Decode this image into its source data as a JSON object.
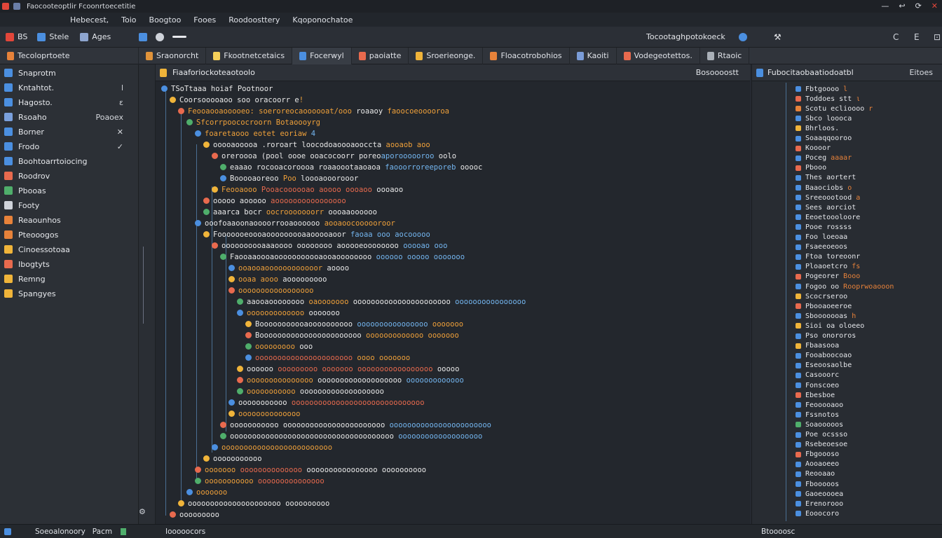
{
  "window": {
    "title": "Faocooteoptlir Fcoonrtoecetitie",
    "controls": [
      "—",
      "↩",
      "⟳",
      "✕"
    ]
  },
  "menubar": {
    "items": [
      "Hebecest,",
      "Toio",
      "Boogtoo",
      "Fooes",
      "Roodoosttery",
      "Kqoponochatoe"
    ]
  },
  "toolbar": {
    "left": [
      {
        "icon": "app-icon",
        "label": "BS"
      },
      {
        "icon": "style-icon",
        "label": "Stele"
      },
      {
        "icon": "apps-icon",
        "label": "Ages"
      }
    ],
    "center_title": "Tocootaghpotokoeck",
    "controls": [
      "C",
      "E",
      "⊡"
    ]
  },
  "tabs": [
    {
      "label": "Sraonorcht",
      "active": false,
      "color": "#e0933a"
    },
    {
      "label": "Fkootnetcetaics",
      "active": false,
      "color": "#f5d05a"
    },
    {
      "label": "Focerwyl",
      "active": true,
      "color": "#4b8fe0"
    },
    {
      "label": "paoiatte",
      "active": false,
      "color": "#e86a4e"
    },
    {
      "label": "Sroerieonge.",
      "active": false,
      "color": "#f0b43a"
    },
    {
      "label": "Floacotrobohios",
      "active": false,
      "color": "#e7823a"
    },
    {
      "label": "Kaoiti",
      "active": false,
      "color": "#7a9cd8"
    },
    {
      "label": "Vodegeotettos.",
      "active": false,
      "color": "#e86a4e"
    },
    {
      "label": "Rtaoic",
      "active": false,
      "color": "#aab0b8"
    }
  ],
  "sidebar": {
    "header": "Tecoloprtoete",
    "items": [
      {
        "label": "Snaprotm",
        "color": "#4b8fe0",
        "meta": ""
      },
      {
        "label": "Kntahtot.",
        "color": "#4b8fe0",
        "meta": "l"
      },
      {
        "label": "Hagosto.",
        "color": "#4b8fe0",
        "meta": "ε"
      },
      {
        "label": "Rsoaho",
        "color": "#7aa0dc",
        "meta": "Poaoex"
      },
      {
        "label": "Borner",
        "color": "#4b8fe0",
        "meta": "✕"
      },
      {
        "label": "Frodo",
        "color": "#4b8fe0",
        "meta": "✓"
      },
      {
        "label": "Boohtoarrtoiocing",
        "color": "#4b8fe0",
        "meta": ""
      },
      {
        "label": "Roodrov",
        "color": "#e86a4e",
        "meta": ""
      },
      {
        "label": "Pbooas",
        "color": "#4fae6b",
        "meta": ""
      },
      {
        "label": "Footy",
        "color": "#cfd3da",
        "meta": ""
      },
      {
        "label": "Reaounhos",
        "color": "#e7823a",
        "meta": ""
      },
      {
        "label": "Pteooogos",
        "color": "#e7823a",
        "meta": ""
      },
      {
        "label": "Cinoessotoaa",
        "color": "#f0b43a",
        "meta": ""
      },
      {
        "label": "Ibogtyts",
        "color": "#e86a4e",
        "meta": ""
      },
      {
        "label": "Remng",
        "color": "#f0b43a",
        "meta": ""
      },
      {
        "label": "Spangyes",
        "color": "#f0b43a",
        "meta": ""
      }
    ]
  },
  "editor": {
    "title": "Fiaaforiockoteaotoolo",
    "right_label": "Bosoooostt"
  },
  "outline": {
    "title": "Fubocitaobaatiodoatbl",
    "right_label": "Eitoes",
    "items": [
      {
        "label": "Fbtgoooo",
        "color": "#4b8fe0",
        "extra": "l"
      },
      {
        "label": "Toddoes stt",
        "color": "#e86a4e",
        "extra": "ι"
      },
      {
        "label": "Scotu eclioooo",
        "color": "#e7823a",
        "extra": "r"
      },
      {
        "label": "Sbco loooca",
        "color": "#4b8fe0",
        "extra": ""
      },
      {
        "label": "Bhrloos.",
        "color": "#f0b43a",
        "extra": ""
      },
      {
        "label": "Soaaqqooroo",
        "color": "#4b8fe0",
        "extra": ""
      },
      {
        "label": "Koooor",
        "color": "#e86a4e",
        "extra": ""
      },
      {
        "label": "Poceg",
        "color": "#4b8fe0",
        "extra": "aaaar"
      },
      {
        "label": "Pbooo",
        "color": "#e86a4e",
        "extra": ""
      },
      {
        "label": "Thes aortert",
        "color": "#4b8fe0",
        "extra": ""
      },
      {
        "label": "Baaociobs",
        "color": "#4b8fe0",
        "extra": "o"
      },
      {
        "label": "Sreeoootood",
        "color": "#4b8fe0",
        "extra": "a"
      },
      {
        "label": "Sees aorciot",
        "color": "#4b8fe0",
        "extra": ""
      },
      {
        "label": "Eeoetoooloore",
        "color": "#4b8fe0",
        "extra": ""
      },
      {
        "label": "Pooe rossss",
        "color": "#4b8fe0",
        "extra": ""
      },
      {
        "label": "Foo loeoaa",
        "color": "#4b8fe0",
        "extra": ""
      },
      {
        "label": "Fsaeeoeoos",
        "color": "#4b8fe0",
        "extra": ""
      },
      {
        "label": "Ftoa toreoonr",
        "color": "#4b8fe0",
        "extra": ""
      },
      {
        "label": "Ploaoetcro",
        "color": "#4b8fe0",
        "extra": "fs"
      },
      {
        "label": "Pogeorer",
        "color": "#e86a4e",
        "extra": "Booo"
      },
      {
        "label": "Fogoo oo",
        "color": "#4b8fe0",
        "extra": "Rooprwoaooon"
      },
      {
        "label": "Scocrseroo",
        "color": "#f0b43a",
        "extra": ""
      },
      {
        "label": "Pbooaoeeroe",
        "color": "#e86a4e",
        "extra": ""
      },
      {
        "label": "Sbooooooas",
        "color": "#4b8fe0",
        "extra": "h"
      },
      {
        "label": "Sioi oa oloeeo",
        "color": "#f0b43a",
        "extra": ""
      },
      {
        "label": "Pso onororos",
        "color": "#4b8fe0",
        "extra": ""
      },
      {
        "label": "Fbaasooa",
        "color": "#f0b43a",
        "extra": ""
      },
      {
        "label": "Fooaboocoao",
        "color": "#4b8fe0",
        "extra": ""
      },
      {
        "label": "Eseoosaolbe",
        "color": "#4b8fe0",
        "extra": ""
      },
      {
        "label": "Casooorc",
        "color": "#4b8fe0",
        "extra": ""
      },
      {
        "label": "Fonscoeo",
        "color": "#4b8fe0",
        "extra": ""
      },
      {
        "label": "Ebesboe",
        "color": "#e86a4e",
        "extra": ""
      },
      {
        "label": "Feooooaoo",
        "color": "#4b8fe0",
        "extra": ""
      },
      {
        "label": "Fssnotos",
        "color": "#4b8fe0",
        "extra": ""
      },
      {
        "label": "Soaooooos",
        "color": "#4fae6b",
        "extra": ""
      },
      {
        "label": "Poe ocssso",
        "color": "#4b8fe0",
        "extra": ""
      },
      {
        "label": "Rsebeoesoe",
        "color": "#4b8fe0",
        "extra": ""
      },
      {
        "label": "Fbgoooso",
        "color": "#e86a4e",
        "extra": ""
      },
      {
        "label": "Aooaoeeo",
        "color": "#4b8fe0",
        "extra": ""
      },
      {
        "label": "Reooaao",
        "color": "#4b8fe0",
        "extra": ""
      },
      {
        "label": "Fbooooos",
        "color": "#4b8fe0",
        "extra": ""
      },
      {
        "label": "Gaoeoooea",
        "color": "#4b8fe0",
        "extra": ""
      },
      {
        "label": "Erenorooo",
        "color": "#4b8fe0",
        "extra": ""
      },
      {
        "label": "Eooocoro",
        "color": "#4b8fe0",
        "extra": ""
      }
    ]
  },
  "code_lines": [
    {
      "indent": 0,
      "tokens": [
        {
          "c": "w",
          "t": "TSoTtaaa hoiaf Pootnoor"
        }
      ]
    },
    {
      "indent": 1,
      "tokens": [
        {
          "c": "w",
          "t": "Coorsooooaoo soo oracoorr e"
        },
        {
          "c": "o",
          "t": "!"
        }
      ]
    },
    {
      "indent": 2,
      "tokens": [
        {
          "c": "o",
          "t": "Feooaooaooooeo: soeroreocaoooooat/ooo"
        },
        {
          "c": "w",
          "t": " roaaoy"
        },
        {
          "c": "o",
          "t": " faoocoeooooroa"
        }
      ]
    },
    {
      "indent": 3,
      "tokens": [
        {
          "c": "o",
          "t": "Sfcorrpoococroorn Botaoooyrg"
        }
      ]
    },
    {
      "indent": 4,
      "tokens": [
        {
          "c": "o",
          "t": "foaretaooo eotet eoriaw"
        },
        {
          "c": "b",
          "t": " 4"
        }
      ]
    },
    {
      "indent": 5,
      "tokens": [
        {
          "c": "w",
          "t": "ooooaooooa .roroart loocodoaoooaooccta"
        },
        {
          "c": "o",
          "t": " aooaob aoo"
        }
      ]
    },
    {
      "indent": 6,
      "tokens": [
        {
          "c": "w",
          "t": "oreroooa (pool oooe ooacocoorr poreo"
        },
        {
          "c": "b",
          "t": "aporoooooroo"
        },
        {
          "c": "w",
          "t": " oolo"
        }
      ]
    },
    {
      "indent": 7,
      "tokens": [
        {
          "c": "w",
          "t": "eaaao rocooacoroooa roaaoootaaoaoa"
        },
        {
          "c": "b",
          "t": " faooorroreeporeb"
        },
        {
          "c": "w",
          "t": " ooooc"
        }
      ]
    },
    {
      "indent": 7,
      "tokens": [
        {
          "c": "w",
          "t": "Booooaoreoo"
        },
        {
          "c": "o",
          "t": " Poo"
        },
        {
          "c": "w",
          "t": " loooaooorooor"
        }
      ]
    },
    {
      "indent": 6,
      "tokens": [
        {
          "c": "o",
          "t": "Feooaooo"
        },
        {
          "c": "r",
          "t": " Pooacoooooao aoooo oooaoo"
        },
        {
          "c": "w",
          "t": " oooaoo"
        }
      ]
    },
    {
      "indent": 5,
      "tokens": [
        {
          "c": "w",
          "t": "ooooo aooooo"
        },
        {
          "c": "r",
          "t": " aoooooooooooooooo"
        }
      ]
    },
    {
      "indent": 5,
      "tokens": [
        {
          "c": "w",
          "t": "aaarca bocr"
        },
        {
          "c": "o",
          "t": " oocrooooooorr"
        },
        {
          "c": "w",
          "t": " oooaaoooooo"
        }
      ]
    },
    {
      "indent": 4,
      "tokens": [
        {
          "c": "w",
          "t": "ooofoaaoonaoooorrooaoooooo"
        },
        {
          "c": "o",
          "t": " aooaoocoooooroor"
        }
      ]
    },
    {
      "indent": 5,
      "tokens": [
        {
          "c": "w",
          "t": "Fooooooeoooaooooooooaaooooaoor"
        },
        {
          "c": "b",
          "t": " faoaa ooo aocooooo"
        }
      ]
    },
    {
      "indent": 6,
      "tokens": [
        {
          "c": "w",
          "t": "oooooooooaaaoooo oooooooo aooooeoooooooo"
        },
        {
          "c": "b",
          "t": " ooooao ooo"
        }
      ]
    },
    {
      "indent": 7,
      "tokens": [
        {
          "c": "w",
          "t": "Faooaaoooaooooooooooaooaoooooooo"
        },
        {
          "c": "b",
          "t": " oooooo ooooo ooooooo"
        }
      ]
    },
    {
      "indent": 8,
      "tokens": [
        {
          "c": "o",
          "t": "ooaooaoooooooooooor"
        },
        {
          "c": "w",
          "t": " aoooo"
        }
      ]
    },
    {
      "indent": 8,
      "tokens": [
        {
          "c": "o",
          "t": "ooaa aooo"
        },
        {
          "c": "w",
          "t": " aooooooooo"
        }
      ]
    },
    {
      "indent": 8,
      "tokens": [
        {
          "c": "o",
          "t": "ooooooooooooooooo"
        }
      ]
    },
    {
      "indent": 9,
      "tokens": [
        {
          "c": "w",
          "t": "aaooaoooooooo"
        },
        {
          "c": "o",
          "t": " oaooooooo"
        },
        {
          "c": "w",
          "t": " oooooooooooooooooooooo"
        },
        {
          "c": "b",
          "t": " oooooooooooooooo"
        }
      ]
    },
    {
      "indent": 9,
      "tokens": [
        {
          "c": "o",
          "t": "ooooooooooooo"
        },
        {
          "c": "w",
          "t": " ooooooo"
        }
      ]
    },
    {
      "indent": 10,
      "tokens": [
        {
          "c": "w",
          "t": "Booooooooooaoooooooooo"
        },
        {
          "c": "b",
          "t": " oooooooooooooooo"
        },
        {
          "c": "o",
          "t": " ooooooo"
        }
      ]
    },
    {
      "indent": 10,
      "tokens": [
        {
          "c": "w",
          "t": "Booooooooooooooooooooooo"
        },
        {
          "c": "o",
          "t": " ooooooooooooo ooooooo"
        }
      ]
    },
    {
      "indent": 10,
      "tokens": [
        {
          "c": "o",
          "t": "ooooooooo"
        },
        {
          "c": "w",
          "t": " ooo"
        }
      ]
    },
    {
      "indent": 10,
      "tokens": [
        {
          "c": "r",
          "t": "oooooooooooooooooooooo"
        },
        {
          "c": "o",
          "t": " oooo ooooooo"
        }
      ]
    },
    {
      "indent": 9,
      "tokens": [
        {
          "c": "w",
          "t": "oooooo"
        },
        {
          "c": "r",
          "t": " ooooooooo ooooooo ooooooooooooooooo"
        },
        {
          "c": "w",
          "t": " ooooo"
        }
      ]
    },
    {
      "indent": 9,
      "tokens": [
        {
          "c": "o",
          "t": "ooooooooooooooo"
        },
        {
          "c": "w",
          "t": " ooooooooooooooooooo"
        },
        {
          "c": "b",
          "t": " ooooooooooooo"
        }
      ]
    },
    {
      "indent": 9,
      "tokens": [
        {
          "c": "o",
          "t": "ooooooooooo"
        },
        {
          "c": "w",
          "t": " ooooooooooooooooooo"
        }
      ]
    },
    {
      "indent": 8,
      "tokens": [
        {
          "c": "w",
          "t": "ooooooooooo"
        },
        {
          "c": "r",
          "t": " oooooooooooooooooooooooooooooo"
        }
      ]
    },
    {
      "indent": 8,
      "tokens": [
        {
          "c": "o",
          "t": "oooooooooooooo"
        }
      ]
    },
    {
      "indent": 7,
      "tokens": [
        {
          "c": "w",
          "t": "ooooooooooo"
        },
        {
          "c": "w",
          "t": " ooooooooooooooooooooooo"
        },
        {
          "c": "b",
          "t": " ooooooooooooooooooooooo"
        }
      ]
    },
    {
      "indent": 7,
      "tokens": [
        {
          "c": "w",
          "t": "ooooooooooooooooooooooooooooooooooooo"
        },
        {
          "c": "b",
          "t": " ooooooooooooooooooo"
        }
      ]
    },
    {
      "indent": 6,
      "tokens": [
        {
          "c": "o",
          "t": "ooooooooooooooooooooooooo"
        }
      ]
    },
    {
      "indent": 5,
      "tokens": [
        {
          "c": "w",
          "t": "ooooooooooo"
        }
      ]
    },
    {
      "indent": 4,
      "tokens": [
        {
          "c": "o",
          "t": "ooooooo"
        },
        {
          "c": "r",
          "t": " oooooooooooooo"
        },
        {
          "c": "w",
          "t": " oooooooooooooooo oooooooooo"
        }
      ]
    },
    {
      "indent": 4,
      "tokens": [
        {
          "c": "o",
          "t": "ooooooooooo"
        },
        {
          "c": "r",
          "t": " ooooooooooooooo"
        }
      ]
    },
    {
      "indent": 3,
      "tokens": [
        {
          "c": "o",
          "t": "ooooooo"
        }
      ]
    },
    {
      "indent": 2,
      "tokens": [
        {
          "c": "w",
          "t": "ooooooooooooooooooooo"
        },
        {
          "c": "w",
          "t": " oooooooooo"
        }
      ]
    },
    {
      "indent": 1,
      "tokens": [
        {
          "c": "w",
          "t": "ooooooooo"
        }
      ]
    }
  ],
  "status": {
    "left": "Soeoalonoory",
    "mid": "Pacm",
    "editor": "Iooooocors",
    "right": "Btoooosc"
  }
}
